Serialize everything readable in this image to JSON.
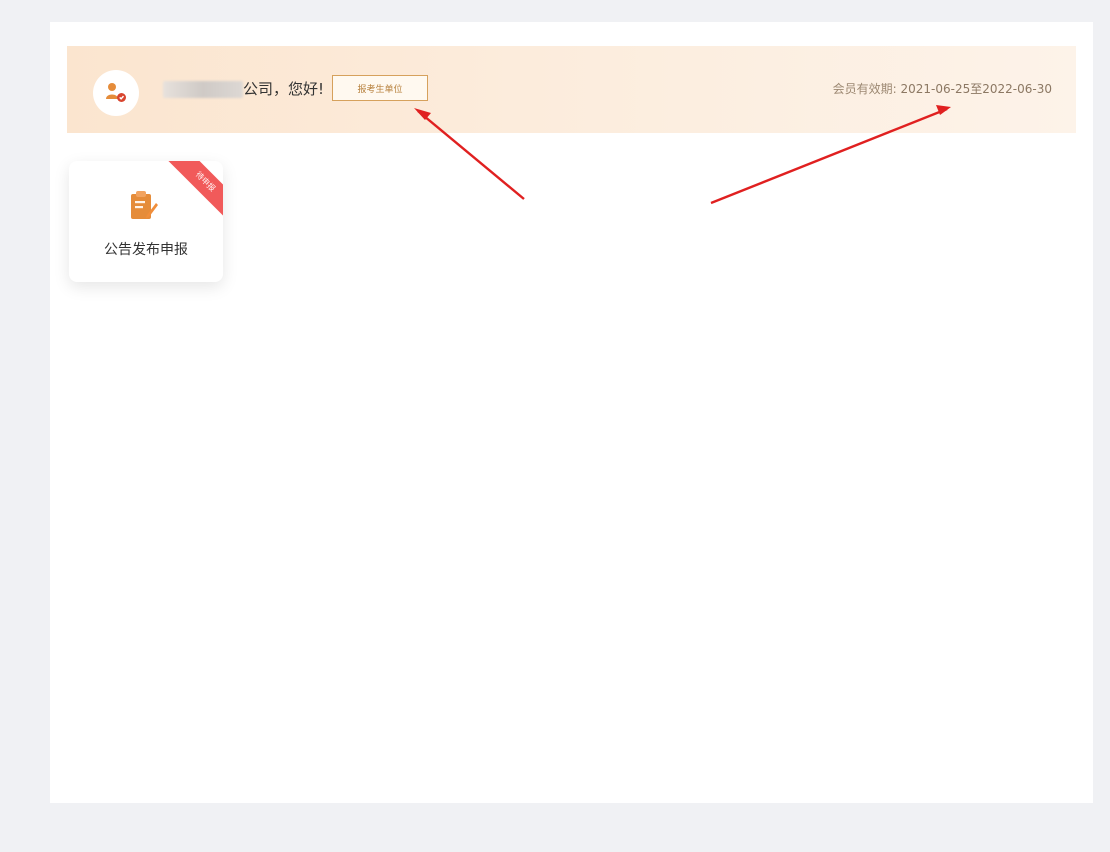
{
  "header": {
    "company_suffix": "公司，您好!",
    "status_button": "报考生单位",
    "membership_label": "会员有效期:",
    "membership_period": "2021-06-25至2022-06-30"
  },
  "service_card": {
    "badge": "待申报",
    "title": "公告发布申报",
    "icon": "clipboard-edit-icon"
  },
  "colors": {
    "accent": "#e38b43",
    "badge": "#f15a5a",
    "arrow": "#e02020",
    "banner": "#fbe5cf"
  },
  "icons": {
    "avatar": "user-badge-icon",
    "annotation": "red-arrow-icon"
  }
}
